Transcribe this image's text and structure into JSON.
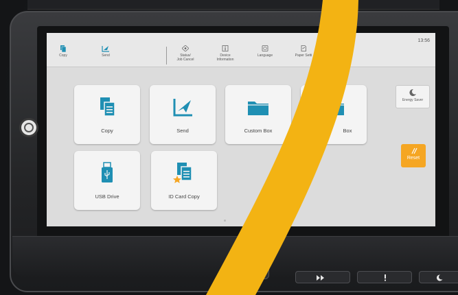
{
  "header": {
    "time": "13:56",
    "favorites": [
      {
        "label": "Copy",
        "icon": "copy-icon"
      },
      {
        "label": "Send",
        "icon": "send-icon"
      }
    ],
    "system_buttons": [
      {
        "line1": "Status/",
        "line2": "Job Cancel",
        "icon": "status-icon"
      },
      {
        "line1": "Device",
        "line2": "Information",
        "icon": "info-icon"
      },
      {
        "line1": "Language",
        "line2": "",
        "icon": "globe-icon"
      },
      {
        "line1": "Paper Setti",
        "line2": "",
        "icon": "paper-icon"
      }
    ]
  },
  "tiles": [
    {
      "label": "Copy",
      "icon": "copy-icon"
    },
    {
      "label": "Send",
      "icon": "send-icon"
    },
    {
      "label": "Custom Box",
      "icon": "folder-icon"
    },
    {
      "label": "Box",
      "icon": "folder-icon"
    },
    {
      "label": "USB Drive",
      "icon": "usb-icon"
    },
    {
      "label": "ID Card Copy",
      "icon": "id-card-copy-icon"
    }
  ],
  "side_buttons": {
    "energy_saver": "Energy Saver",
    "reset": "Reset"
  },
  "colors": {
    "accent": "#1f8fb3",
    "reset": "#f5a623",
    "swoosh": "#f3b313"
  },
  "hardware_icons": [
    "fast-forward-icon",
    "info-icon",
    "sleep-icon"
  ]
}
